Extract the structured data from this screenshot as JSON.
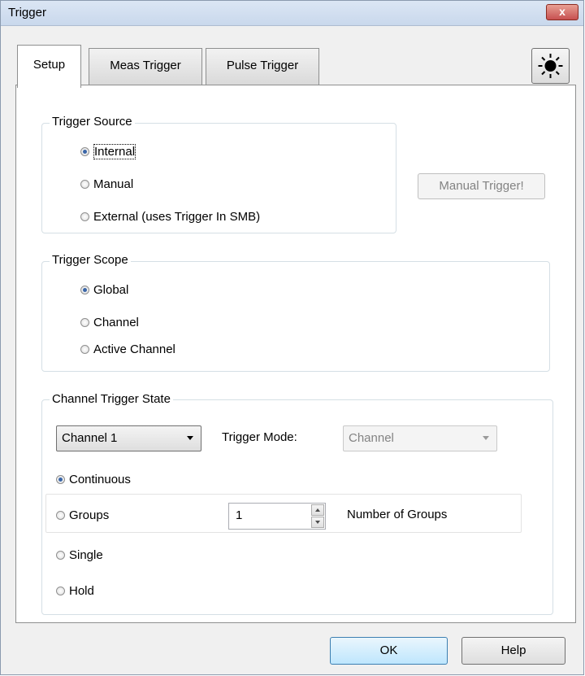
{
  "window": {
    "title": "Trigger",
    "close_glyph": "x"
  },
  "tabs": [
    "Setup",
    "Meas Trigger",
    "Pulse Trigger"
  ],
  "brightness_icon": "sun-icon",
  "trigger_source": {
    "label": "Trigger Source",
    "options": [
      {
        "label": "Internal",
        "selected": true
      },
      {
        "label": "Manual",
        "selected": false
      },
      {
        "label": "External (uses Trigger In SMB)",
        "selected": false
      }
    ],
    "manual_trigger_button": "Manual Trigger!"
  },
  "trigger_scope": {
    "label": "Trigger Scope",
    "options": [
      {
        "label": "Global",
        "selected": true
      },
      {
        "label": "Channel",
        "selected": false
      },
      {
        "label": "Active Channel",
        "selected": false
      }
    ]
  },
  "channel_trigger_state": {
    "label": "Channel Trigger State",
    "channel_select": "Channel 1",
    "trigger_mode_label": "Trigger Mode:",
    "trigger_mode_value": "Channel",
    "options": [
      {
        "label": "Continuous",
        "selected": true
      },
      {
        "label": "Groups",
        "selected": false
      },
      {
        "label": "Single",
        "selected": false
      },
      {
        "label": "Hold",
        "selected": false
      }
    ],
    "groups_value": "1",
    "groups_label": "Number of Groups"
  },
  "footer": {
    "ok": "OK",
    "help": "Help"
  }
}
